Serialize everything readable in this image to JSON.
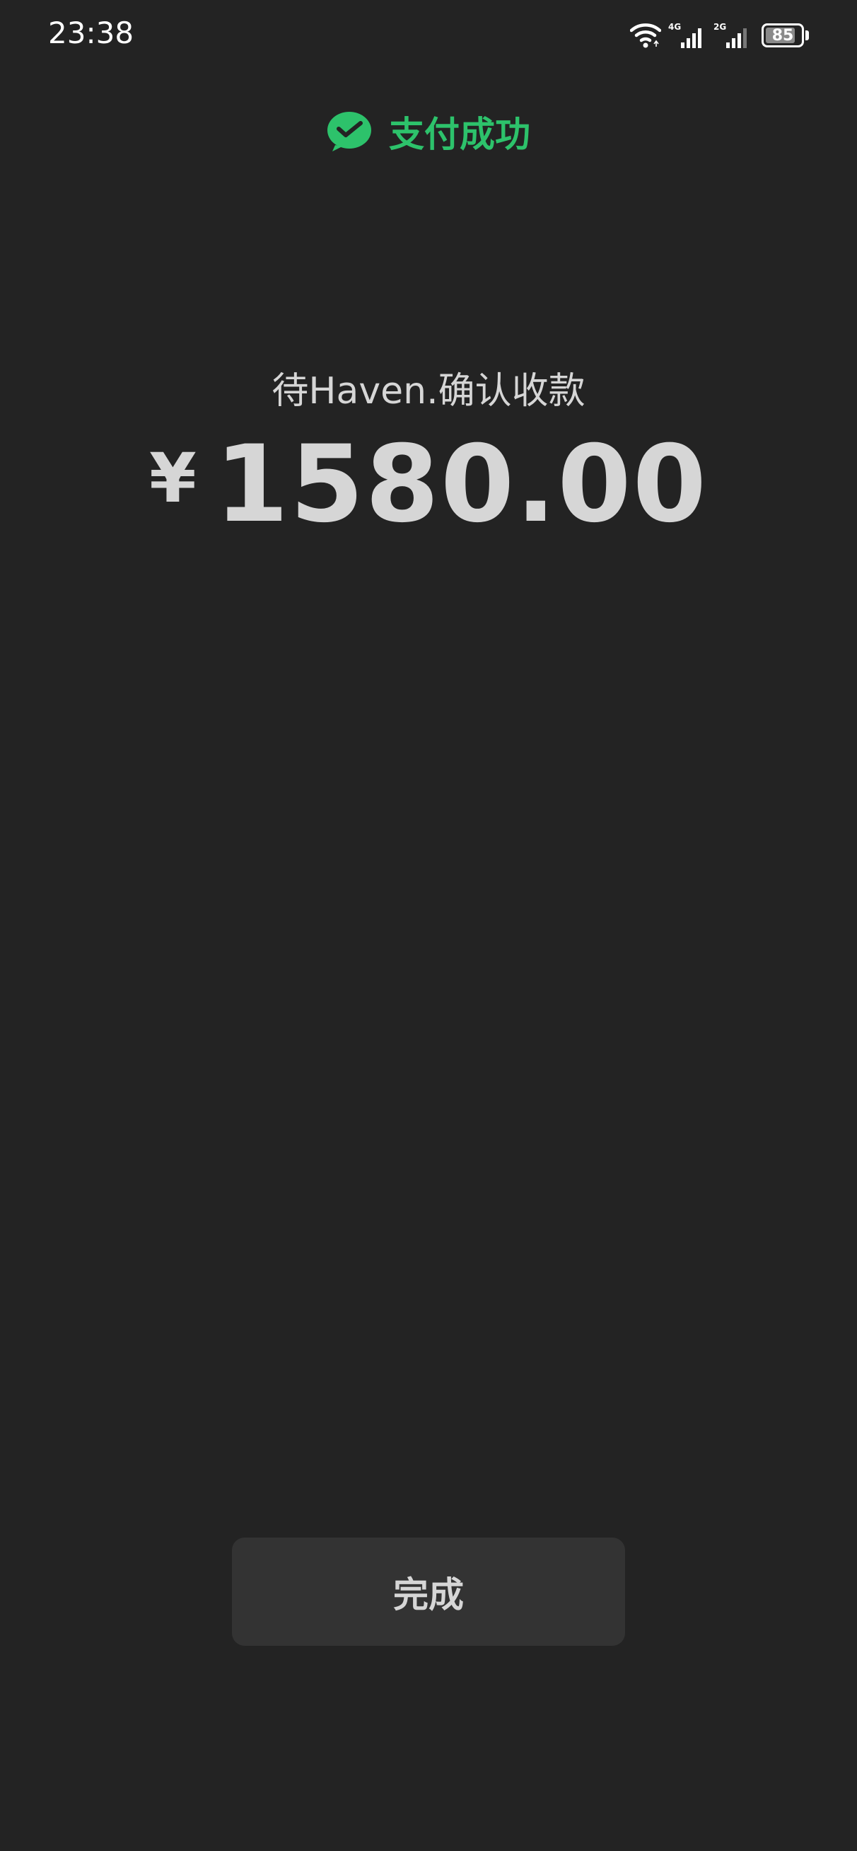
{
  "status_bar": {
    "time": "23:38",
    "network_1": "4G",
    "network_2": "2G",
    "battery_level": 85,
    "battery_text": "85"
  },
  "header": {
    "title": "支付成功",
    "icon": "wechat-pay-check-icon",
    "accent_color": "#2dc26b"
  },
  "payment": {
    "recipient_text": "待Haven.确认收款",
    "currency_symbol": "¥",
    "amount": "1580.00"
  },
  "actions": {
    "done_label": "完成"
  },
  "colors": {
    "background": "#232323",
    "button_bg": "#333333",
    "text": "#d6d6d6"
  }
}
